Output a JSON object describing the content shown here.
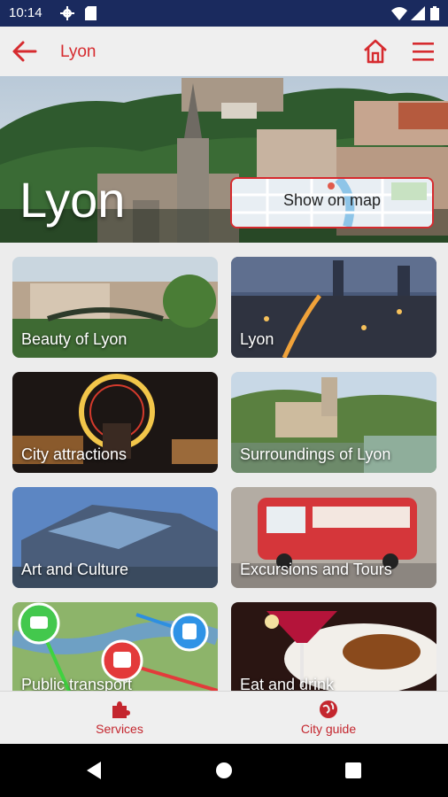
{
  "status_bar": {
    "time": "10:14",
    "icons": [
      "settings-icon",
      "sim-card-icon",
      "wifi-icon",
      "signal-icon",
      "battery-icon"
    ]
  },
  "app_bar": {
    "title": "Lyon",
    "back_icon": "arrow-left-icon",
    "home_icon": "home-icon",
    "menu_icon": "hamburger-menu-icon"
  },
  "hero": {
    "city_name": "Lyon",
    "map_button_label": "Show on map"
  },
  "categories": [
    {
      "label": "Beauty of Lyon"
    },
    {
      "label": "Lyon"
    },
    {
      "label": "City attractions"
    },
    {
      "label": "Surroundings of Lyon"
    },
    {
      "label": "Art and Culture"
    },
    {
      "label": "Excursions and Tours"
    },
    {
      "label": "Public transport"
    },
    {
      "label": "Eat and drink"
    }
  ],
  "bottom_nav": [
    {
      "label": "Services",
      "icon": "puzzle-piece-icon"
    },
    {
      "label": "City guide",
      "icon": "globe-icon"
    }
  ],
  "system_nav": {
    "back": "back-triangle-icon",
    "home": "home-circle-icon",
    "recents": "recents-square-icon"
  },
  "colors": {
    "accent": "#d62b2f",
    "status_bar": "#1a2a5e",
    "app_bar": "#efefef"
  }
}
